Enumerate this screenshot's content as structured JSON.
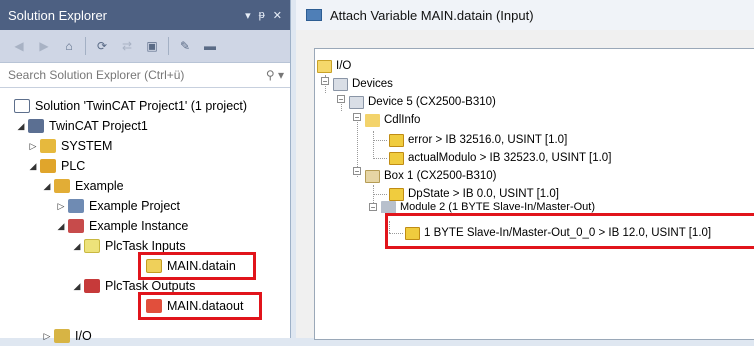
{
  "solution_explorer": {
    "title": "Solution Explorer",
    "controls": [
      "▾",
      "ᵽ",
      "✕"
    ],
    "search_placeholder": "Search Solution Explorer (Ctrl+ü)",
    "tree": [
      {
        "label": "Solution 'TwinCAT Project1' (1 project)",
        "icon": "solution-icon"
      },
      {
        "label": "TwinCAT Project1",
        "icon": "twincat-project-icon"
      },
      {
        "label": "SYSTEM",
        "icon": "system-icon"
      },
      {
        "label": "PLC",
        "icon": "plc-icon"
      },
      {
        "label": "Example",
        "icon": "example-icon"
      },
      {
        "label": "Example Project",
        "icon": "project-icon"
      },
      {
        "label": "Example Instance",
        "icon": "instance-icon"
      },
      {
        "label": "PlcTask Inputs",
        "icon": "inputs-folder-icon"
      },
      {
        "label": "MAIN.datain",
        "icon": "input-variable-icon"
      },
      {
        "label": "PlcTask Outputs",
        "icon": "outputs-folder-icon"
      },
      {
        "label": "MAIN.dataout",
        "icon": "output-variable-icon"
      },
      {
        "label": "I/O",
        "icon": "io-icon"
      }
    ]
  },
  "dialog": {
    "title": "Attach Variable MAIN.datain (Input)",
    "tree": [
      {
        "label": "I/O"
      },
      {
        "label": "Devices"
      },
      {
        "label": "Device 5 (CX2500-B310)"
      },
      {
        "label": "CdlInfo"
      },
      {
        "label": "error  >  IB 32516.0, USINT [1.0]"
      },
      {
        "label": "actualModulo  >  IB 32523.0, USINT [1.0]"
      },
      {
        "label": "Box 1 (CX2500-B310)"
      },
      {
        "label": "DpState  >  IB 0.0, USINT [1.0]"
      },
      {
        "label": "Module 2 (1 BYTE Slave-In/Master-Out)"
      },
      {
        "label": "1 BYTE Slave-In/Master-Out_0_0  >  IB 12.0, USINT [1.0]"
      }
    ]
  },
  "highlight_color": "#e1141b"
}
